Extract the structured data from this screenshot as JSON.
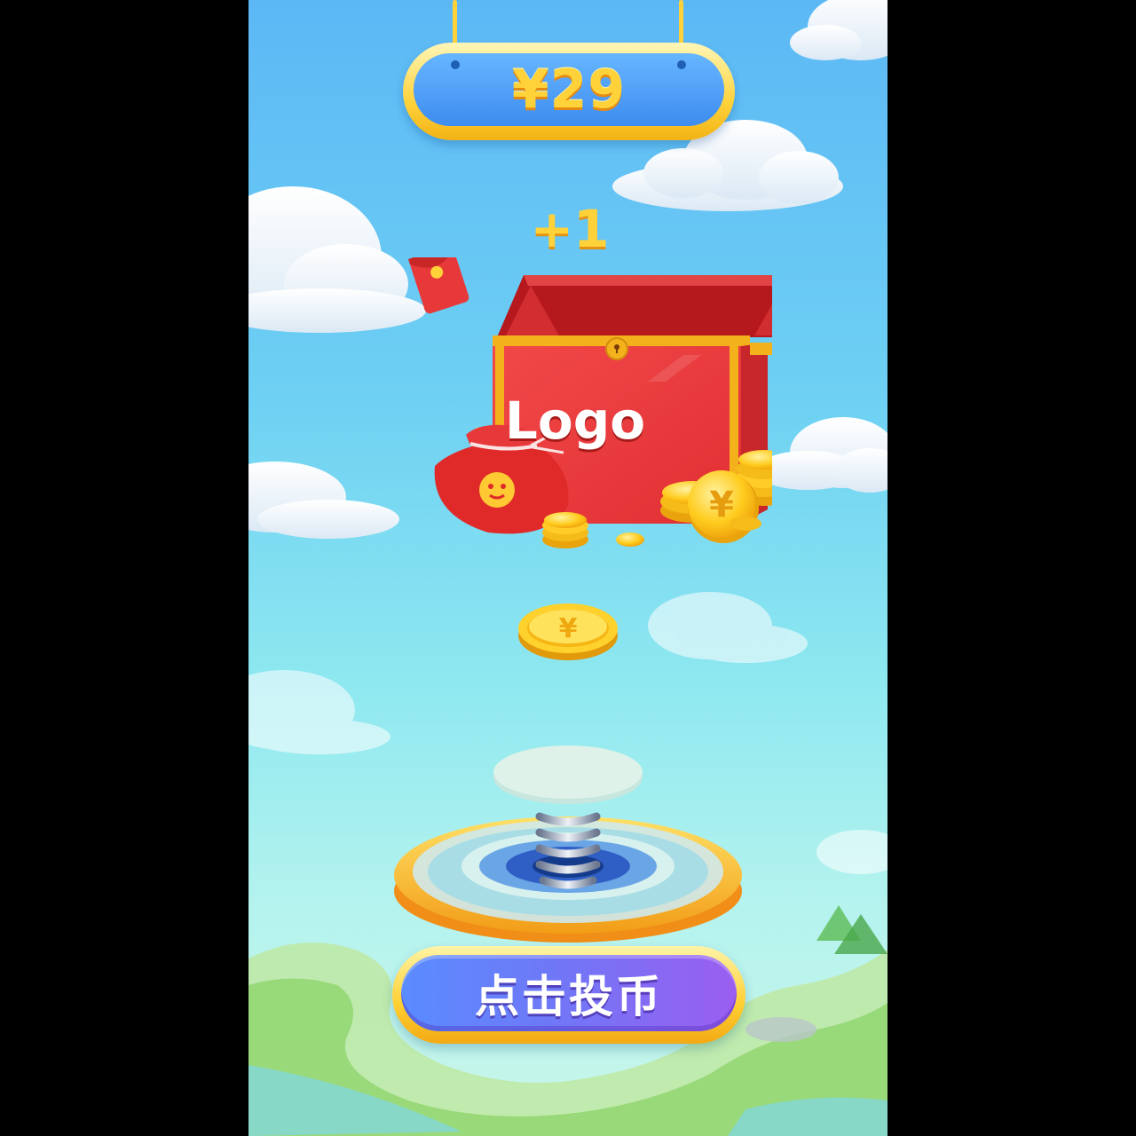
{
  "hud": {
    "balance": "¥29"
  },
  "reward": {
    "increment": "+1"
  },
  "chest": {
    "logo_text": "Logo"
  },
  "controls": {
    "insert_coin_label": "点击投币"
  },
  "icons": {
    "chest": "treasure-chest-icon",
    "coin": "yuan-coin-icon",
    "money_bag": "money-bag-icon",
    "red_envelope": "red-envelope-icon",
    "spring_launcher": "spring-launcher-icon"
  },
  "colors": {
    "accent_gold": "#ffd23a",
    "sign_blue": "#3d8cf0",
    "chest_red": "#e8393a",
    "button_start": "#5a8cff",
    "button_end": "#9b5ef0"
  }
}
